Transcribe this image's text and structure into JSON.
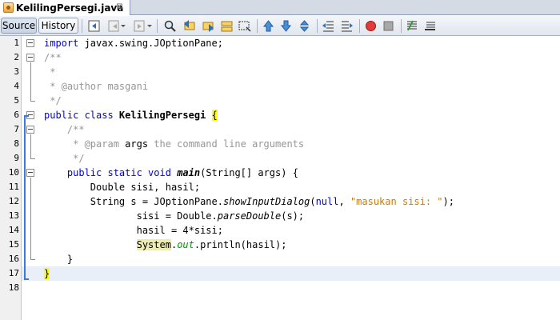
{
  "tab": {
    "title": "KelilingPersegi.java",
    "close_glyph": "⊠"
  },
  "toolbar": {
    "source_label": "Source",
    "history_label": "History",
    "icons": [
      "last-edit-icon",
      "back-icon",
      "forward-icon",
      "find-selection-icon",
      "find-previous-icon",
      "find-next-icon",
      "toggle-highlight-icon",
      "toggle-rect-select-icon",
      "previous-bookmark-icon",
      "next-bookmark-icon",
      "toggle-bookmark-icon",
      "shift-left-icon",
      "shift-right-icon",
      "start-macro-icon",
      "stop-macro-icon",
      "comment-icon",
      "uncomment-icon"
    ]
  },
  "editor": {
    "line_numbers": [
      "1",
      "2",
      "3",
      "4",
      "5",
      "6",
      "7",
      "8",
      "9",
      "10",
      "11",
      "12",
      "13",
      "14",
      "15",
      "16",
      "17",
      "18"
    ],
    "lines": {
      "l1_kw": "import",
      "l1_rest": " javax.swing.JOptionPane;",
      "l2": "/**",
      "l3": " *",
      "l4": " * @author masgani",
      "l5": " */",
      "l6_kw": "public class",
      "l6_name": " KelilingPersegi ",
      "l6_brace": "{",
      "l7": "    /**",
      "l8_pre": "     * ",
      "l8_tag": "@param",
      "l8_arg": " args",
      "l8_rest": " the command line arguments",
      "l9": "     */",
      "l10_indent": "    ",
      "l10_kw": "public static void",
      "l10_sp": " ",
      "l10_name": "main",
      "l10_rest": "(String[] args) {",
      "l11": "        Double sisi, hasil;",
      "l12_pre": "        String s = JOptionPane.",
      "l12_method": "showInputDialog",
      "l12_open": "(",
      "l12_null": "null",
      "l12_comma": ", ",
      "l12_str": "\"masukan sisi: \"",
      "l12_end": ");",
      "l13_pre": "                sisi = Double.",
      "l13_method": "parseDouble",
      "l13_end": "(s);",
      "l14": "                hasil = 4*sisi;",
      "l15_indent": "                ",
      "l15_sys": "System",
      "l15_dot": ".",
      "l15_out": "out",
      "l15_end": ".println(hasil);",
      "l16": "    }",
      "l17": "}"
    }
  },
  "colors": {
    "keyword": "#0000e6",
    "comment": "#969696",
    "string": "#ce7b00",
    "field": "#009900",
    "brace_highlight": "#ffff00",
    "current_line": "#e9eff8"
  }
}
